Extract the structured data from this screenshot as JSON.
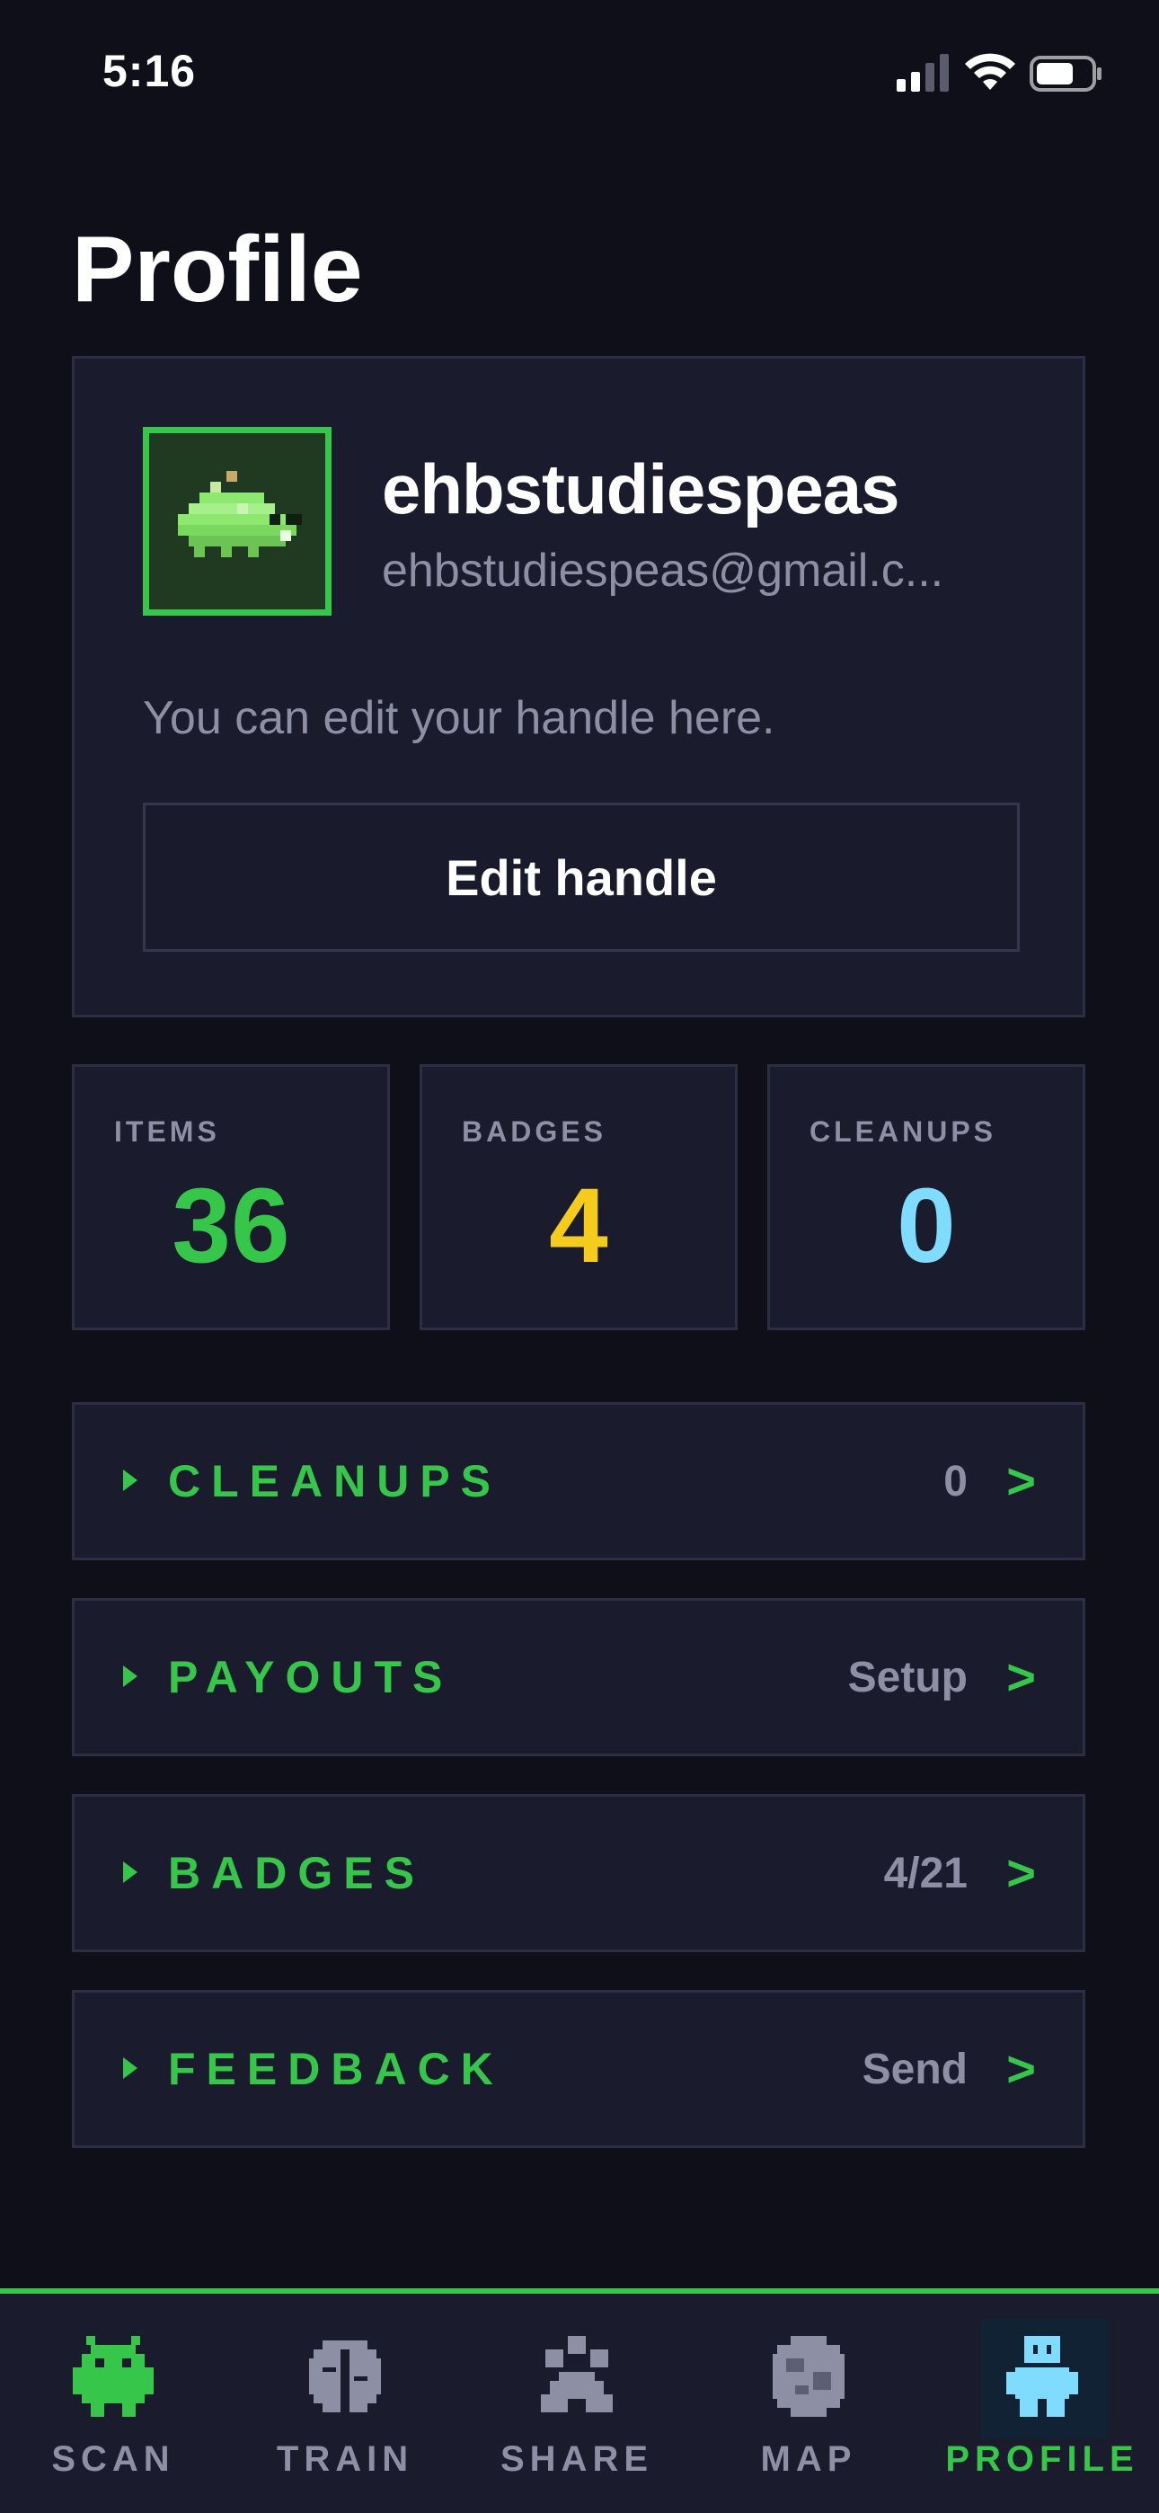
{
  "status_bar": {
    "time": "5:16"
  },
  "page": {
    "title": "Profile"
  },
  "profile": {
    "username": "ehbstudiespeas",
    "email": "ehbstudiespeas@gmail.c...",
    "hint": "You can edit your handle here.",
    "edit_button_label": "Edit handle",
    "avatar_icon": "pixel-creature-icon"
  },
  "stats": [
    {
      "label": "ITEMS",
      "value": "36",
      "color": "#35c64a"
    },
    {
      "label": "BADGES",
      "value": "4",
      "color": "#f5cc1b"
    },
    {
      "label": "CLEANUPS",
      "value": "0",
      "color": "#7fdcff"
    }
  ],
  "rows": [
    {
      "label": "CLEANUPS",
      "value": "0",
      "chevron": ">"
    },
    {
      "label": "PAYOUTS",
      "value": "Setup",
      "chevron": ">"
    },
    {
      "label": "BADGES",
      "value": "4/21",
      "chevron": ">"
    },
    {
      "label": "FEEDBACK",
      "value": "Send",
      "chevron": ">"
    }
  ],
  "nav": {
    "items": [
      {
        "label": "SCAN",
        "icon": "alien-bug-icon",
        "active": false
      },
      {
        "label": "TRAIN",
        "icon": "brain-icon",
        "active": false
      },
      {
        "label": "SHARE",
        "icon": "paw-icon",
        "active": false
      },
      {
        "label": "MAP",
        "icon": "globe-icon",
        "active": false
      },
      {
        "label": "PROFILE",
        "icon": "robot-person-icon",
        "active": true
      }
    ]
  },
  "colors": {
    "background": "#0e0f19",
    "card": "#1a1b2d",
    "border": "#2c2e43",
    "accent": "#35c64a",
    "muted": "#8d8fa5"
  }
}
